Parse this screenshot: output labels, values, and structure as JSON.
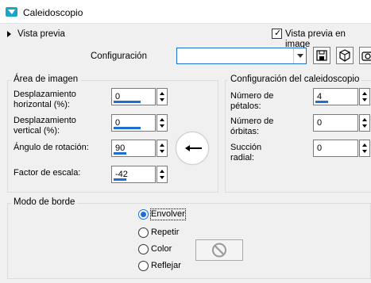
{
  "window": {
    "title": "Caleidoscopio"
  },
  "preview": {
    "expand_label": "Vista previa",
    "checkbox_label": "Vista previa en image",
    "checked": true
  },
  "config": {
    "label": "Configuración",
    "value": ""
  },
  "image_area": {
    "title": "Área de imagen",
    "h_offset": {
      "label_line1": "Desplazamiento",
      "label_line2": "horizontal (%):",
      "value": "0"
    },
    "v_offset": {
      "label_line1": "Desplazamiento",
      "label_line2": "vertical (%):",
      "value": "0"
    },
    "rotation": {
      "label": "Ángulo de rotación:",
      "value": "90"
    },
    "scale": {
      "label": "Factor de escala:",
      "value": "-42"
    }
  },
  "kaleido": {
    "title": "Configuración del caleidoscopio",
    "petals": {
      "label_line1": "Número de",
      "label_line2": "pétalos:",
      "value": "4"
    },
    "orbits": {
      "label_line1": "Número de",
      "label_line2": "órbitas:",
      "value": "0"
    },
    "suction": {
      "label_line1": "Succión",
      "label_line2": "radial:",
      "value": "0"
    }
  },
  "border_mode": {
    "title": "Modo de borde",
    "options": [
      "Envolver",
      "Repetir",
      "Color",
      "Reflejar"
    ],
    "selected": "Envolver"
  },
  "colors": {
    "accent": "#1f6fd1",
    "app_icon": "#1aa6c9"
  }
}
